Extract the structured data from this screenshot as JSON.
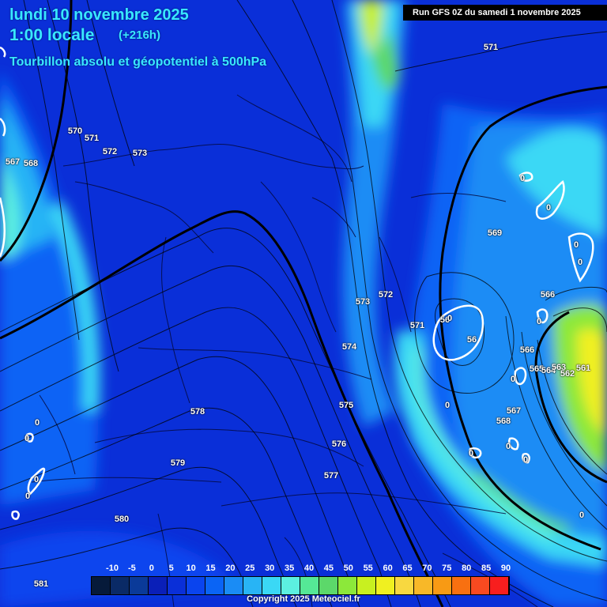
{
  "header": {
    "date": "lundi 10 novembre 2025",
    "time": "1:00 locale",
    "lead": "(+216h)",
    "parameter": "Tourbillon absolu et géopotentiel à 500hPa",
    "run": "Run GFS 0Z du samedi 1 novembre 2025"
  },
  "contour_labels": [
    {
      "id": "a",
      "text": "571"
    },
    {
      "id": "b",
      "text": "570"
    },
    {
      "id": "c",
      "text": "571"
    },
    {
      "id": "d",
      "text": "572"
    },
    {
      "id": "e",
      "text": "573"
    },
    {
      "id": "f",
      "text": "567"
    },
    {
      "id": "g",
      "text": "568"
    },
    {
      "id": "h",
      "text": "569"
    },
    {
      "id": "i",
      "text": "573"
    },
    {
      "id": "j",
      "text": "572"
    },
    {
      "id": "k",
      "text": "571"
    },
    {
      "id": "l",
      "text": "574"
    },
    {
      "id": "m",
      "text": "575"
    },
    {
      "id": "n",
      "text": "576"
    },
    {
      "id": "o",
      "text": "577"
    },
    {
      "id": "p",
      "text": "578"
    },
    {
      "id": "q",
      "text": "579"
    },
    {
      "id": "r",
      "text": "580"
    },
    {
      "id": "s",
      "text": "581"
    },
    {
      "id": "t",
      "text": "566"
    },
    {
      "id": "u",
      "text": "566"
    },
    {
      "id": "v",
      "text": "565"
    },
    {
      "id": "w",
      "text": "564"
    },
    {
      "id": "x",
      "text": "563"
    },
    {
      "id": "y",
      "text": "562"
    },
    {
      "id": "z",
      "text": "561"
    },
    {
      "id": "aa",
      "text": "567"
    },
    {
      "id": "ab",
      "text": "568"
    },
    {
      "id": "ac",
      "text": "56"
    },
    {
      "id": "ad",
      "text": "56"
    }
  ],
  "vorticity_zero_labels": [
    "0",
    "0",
    "0",
    "0",
    "0",
    "0",
    "0",
    "0",
    "0",
    "0",
    "0",
    "0",
    "0",
    "0",
    "0",
    "0"
  ],
  "legend": {
    "ticks": [
      "-10",
      "-5",
      "0",
      "5",
      "10",
      "15",
      "20",
      "25",
      "30",
      "35",
      "40",
      "45",
      "50",
      "55",
      "60",
      "65",
      "70",
      "75",
      "80",
      "85",
      "90"
    ],
    "colors": [
      "#061a3a",
      "#0a2a66",
      "#0a3a99",
      "#0a1fb8",
      "#0a2fd8",
      "#0a44ee",
      "#0a64f5",
      "#1a8cf5",
      "#28b4f5",
      "#3ad8f5",
      "#5cf0e0",
      "#55e896",
      "#5cd86a",
      "#8ce83a",
      "#c8f020",
      "#f0f020",
      "#f8d840",
      "#f8b828",
      "#f89a14",
      "#f87010",
      "#f84a20",
      "#f81e1e"
    ]
  },
  "copyright": "Copyright 2025 Meteociel.fr"
}
